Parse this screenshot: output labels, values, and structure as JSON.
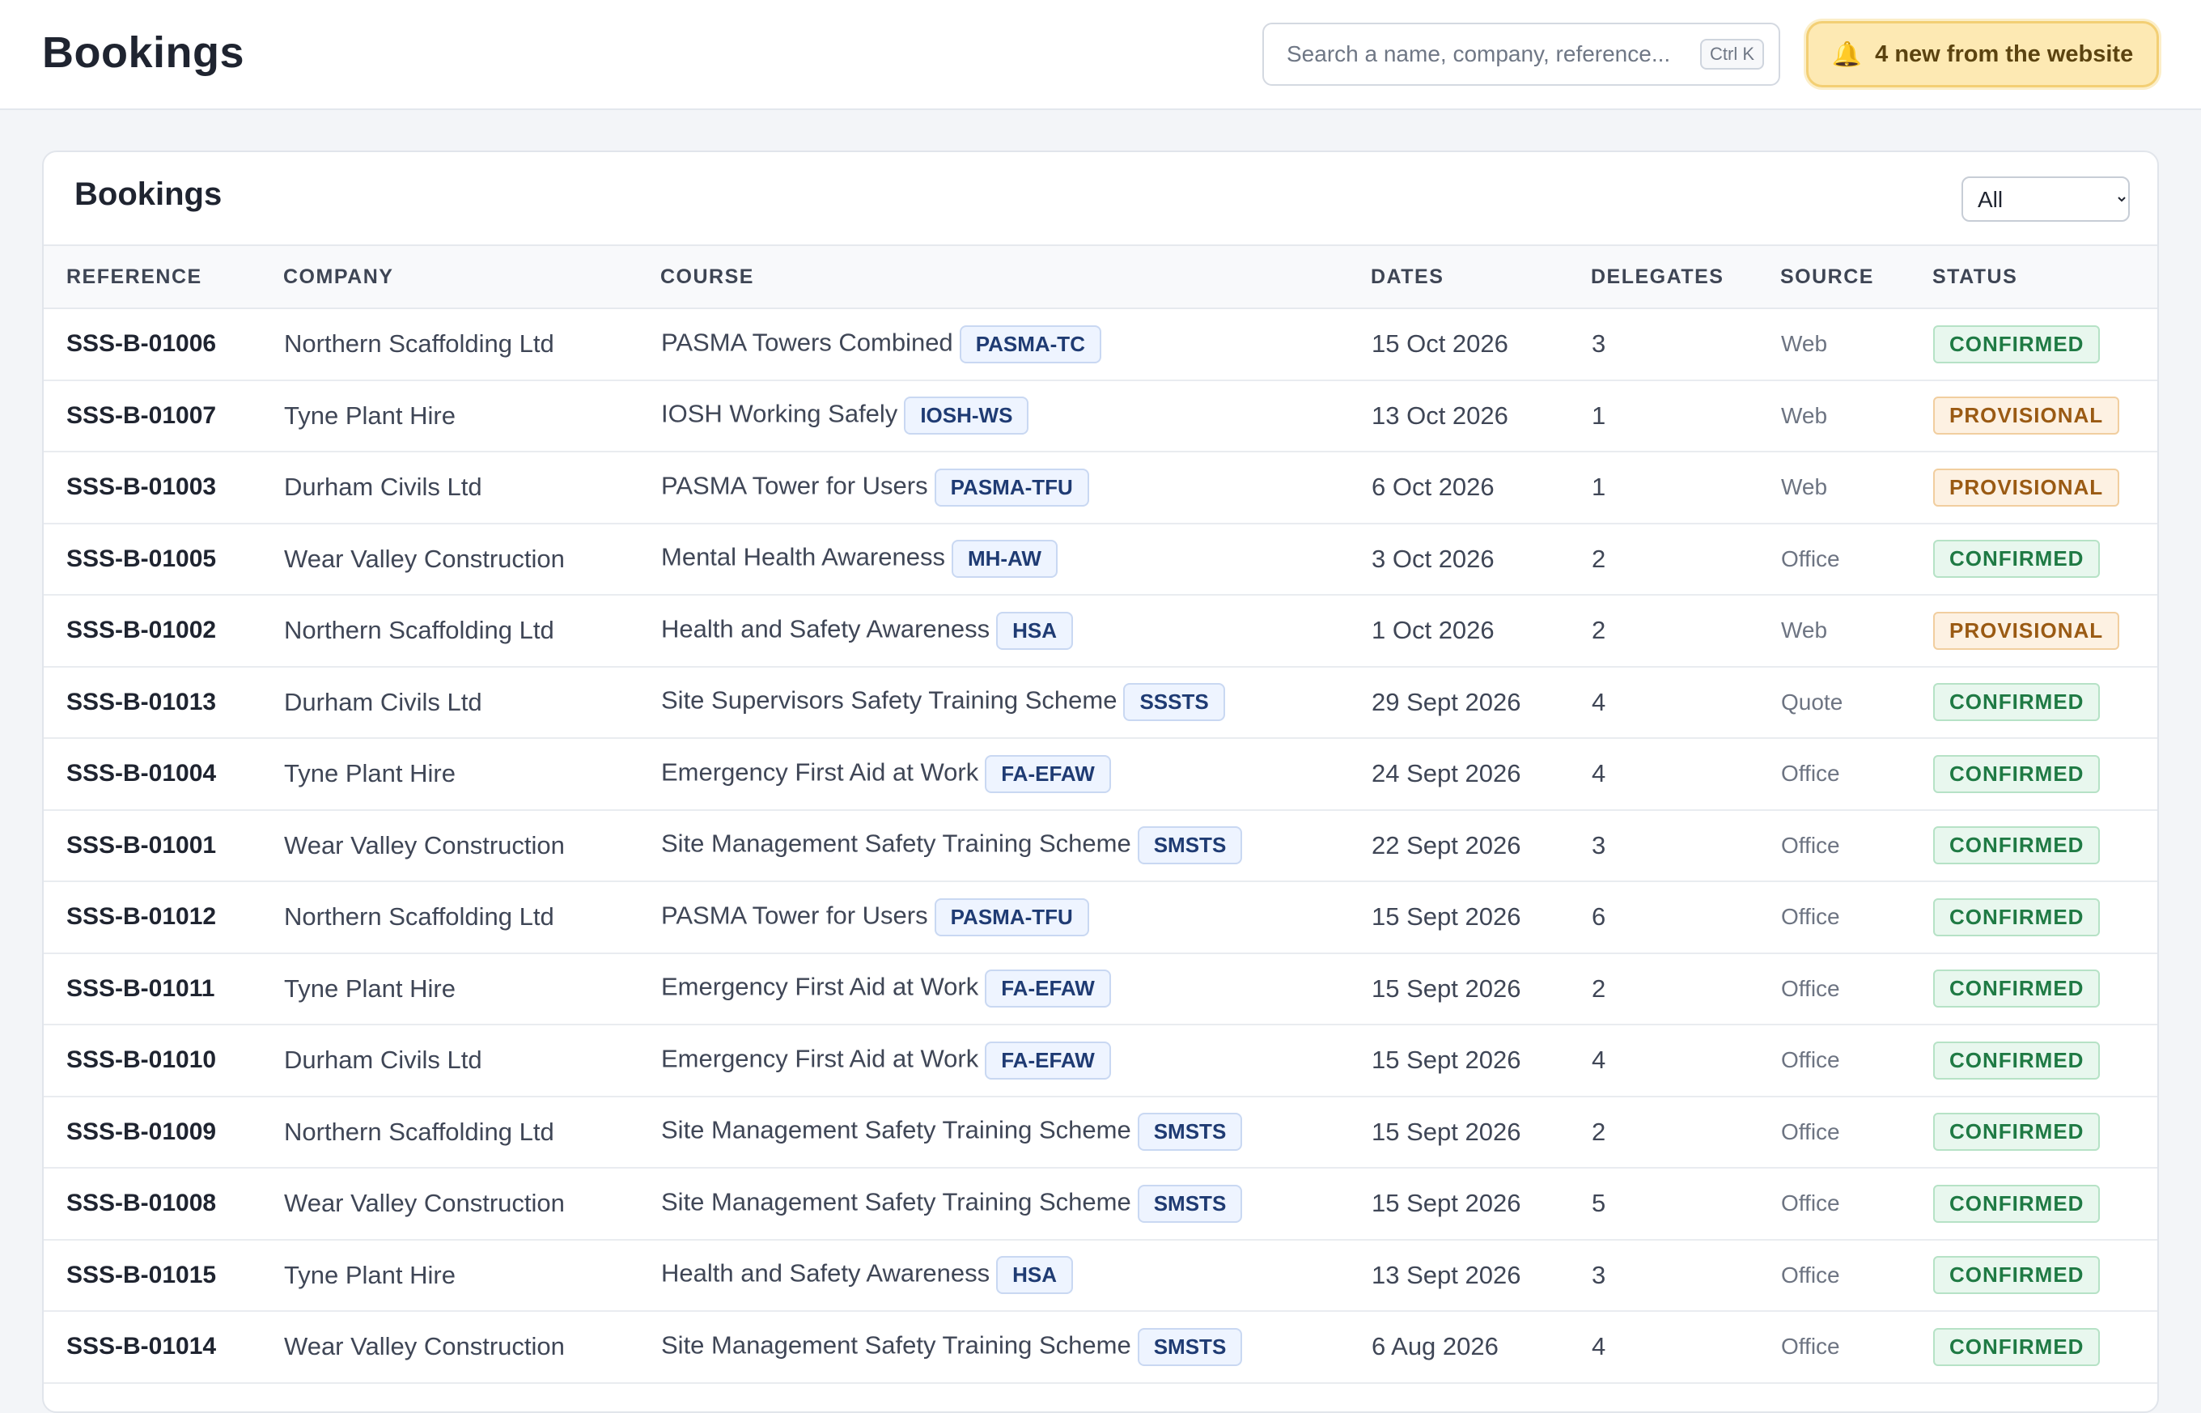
{
  "header": {
    "title": "Bookings",
    "search_placeholder": "Search a name, company, reference...",
    "search_shortcut": "Ctrl K",
    "notification_icon": "bell-icon",
    "notification_label": "4 new from the website"
  },
  "card": {
    "title": "Bookings",
    "filter_selected": "All"
  },
  "table": {
    "columns": [
      "Reference",
      "Company",
      "Course",
      "Dates",
      "Delegates",
      "Source",
      "Status"
    ],
    "rows": [
      {
        "reference": "SSS-B-01006",
        "company": "Northern Scaffolding Ltd",
        "course": "PASMA Towers Combined",
        "code": "PASMA-TC",
        "dates": "15 Oct 2026",
        "delegates": "3",
        "source": "Web",
        "status": "CONFIRMED"
      },
      {
        "reference": "SSS-B-01007",
        "company": "Tyne Plant Hire",
        "course": "IOSH Working Safely",
        "code": "IOSH-WS",
        "dates": "13 Oct 2026",
        "delegates": "1",
        "source": "Web",
        "status": "PROVISIONAL"
      },
      {
        "reference": "SSS-B-01003",
        "company": "Durham Civils Ltd",
        "course": "PASMA Tower for Users",
        "code": "PASMA-TFU",
        "dates": "6 Oct 2026",
        "delegates": "1",
        "source": "Web",
        "status": "PROVISIONAL"
      },
      {
        "reference": "SSS-B-01005",
        "company": "Wear Valley Construction",
        "course": "Mental Health Awareness",
        "code": "MH-AW",
        "dates": "3 Oct 2026",
        "delegates": "2",
        "source": "Office",
        "status": "CONFIRMED"
      },
      {
        "reference": "SSS-B-01002",
        "company": "Northern Scaffolding Ltd",
        "course": "Health and Safety Awareness",
        "code": "HSA",
        "dates": "1 Oct 2026",
        "delegates": "2",
        "source": "Web",
        "status": "PROVISIONAL"
      },
      {
        "reference": "SSS-B-01013",
        "company": "Durham Civils Ltd",
        "course": "Site Supervisors Safety Training Scheme",
        "code": "SSSTS",
        "dates": "29 Sept 2026",
        "delegates": "4",
        "source": "Quote",
        "status": "CONFIRMED"
      },
      {
        "reference": "SSS-B-01004",
        "company": "Tyne Plant Hire",
        "course": "Emergency First Aid at Work",
        "code": "FA-EFAW",
        "dates": "24 Sept 2026",
        "delegates": "4",
        "source": "Office",
        "status": "CONFIRMED"
      },
      {
        "reference": "SSS-B-01001",
        "company": "Wear Valley Construction",
        "course": "Site Management Safety Training Scheme",
        "code": "SMSTS",
        "dates": "22 Sept 2026",
        "delegates": "3",
        "source": "Office",
        "status": "CONFIRMED"
      },
      {
        "reference": "SSS-B-01012",
        "company": "Northern Scaffolding Ltd",
        "course": "PASMA Tower for Users",
        "code": "PASMA-TFU",
        "dates": "15 Sept 2026",
        "delegates": "6",
        "source": "Office",
        "status": "CONFIRMED"
      },
      {
        "reference": "SSS-B-01011",
        "company": "Tyne Plant Hire",
        "course": "Emergency First Aid at Work",
        "code": "FA-EFAW",
        "dates": "15 Sept 2026",
        "delegates": "2",
        "source": "Office",
        "status": "CONFIRMED"
      },
      {
        "reference": "SSS-B-01010",
        "company": "Durham Civils Ltd",
        "course": "Emergency First Aid at Work",
        "code": "FA-EFAW",
        "dates": "15 Sept 2026",
        "delegates": "4",
        "source": "Office",
        "status": "CONFIRMED"
      },
      {
        "reference": "SSS-B-01009",
        "company": "Northern Scaffolding Ltd",
        "course": "Site Management Safety Training Scheme",
        "code": "SMSTS",
        "dates": "15 Sept 2026",
        "delegates": "2",
        "source": "Office",
        "status": "CONFIRMED"
      },
      {
        "reference": "SSS-B-01008",
        "company": "Wear Valley Construction",
        "course": "Site Management Safety Training Scheme",
        "code": "SMSTS",
        "dates": "15 Sept 2026",
        "delegates": "5",
        "source": "Office",
        "status": "CONFIRMED"
      },
      {
        "reference": "SSS-B-01015",
        "company": "Tyne Plant Hire",
        "course": "Health and Safety Awareness",
        "code": "HSA",
        "dates": "13 Sept 2026",
        "delegates": "3",
        "source": "Office",
        "status": "CONFIRMED"
      },
      {
        "reference": "SSS-B-01014",
        "company": "Wear Valley Construction",
        "course": "Site Management Safety Training Scheme",
        "code": "SMSTS",
        "dates": "6 Aug 2026",
        "delegates": "4",
        "source": "Office",
        "status": "CONFIRMED"
      }
    ]
  }
}
